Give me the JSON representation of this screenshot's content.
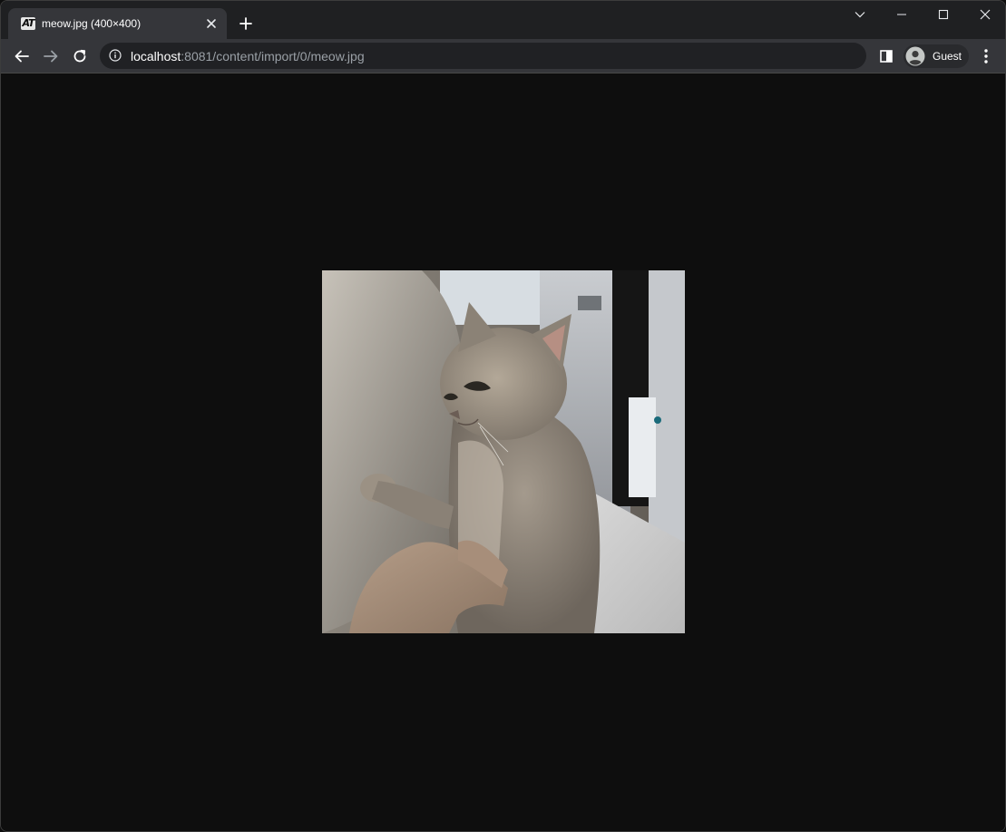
{
  "tab": {
    "favicon_text": "AT",
    "title": "meow.jpg (400×400)",
    "favicon_icon": "at-logo-icon",
    "close_icon": "close-icon"
  },
  "window_controls": {
    "tab_search_icon": "chevron-down-icon",
    "minimize_icon": "minimize-icon",
    "maximize_icon": "maximize-icon",
    "close_icon": "close-icon"
  },
  "toolbar": {
    "back_icon": "arrow-left-icon",
    "forward_icon": "arrow-right-icon",
    "reload_icon": "reload-icon",
    "site_info_icon": "info-icon",
    "url_host": "localhost",
    "url_rest": ":8081/content/import/0/meow.jpg",
    "side_panel_icon": "side-panel-icon",
    "profile_label": "Guest",
    "profile_icon": "avatar-icon",
    "menu_icon": "kebab-menu-icon"
  },
  "content": {
    "image_subject": "photo of a grey kitten sitting on a bed, being held by a hand"
  },
  "colors": {
    "tabstrip_bg": "#1f2022",
    "toolbar_bg": "#35363a",
    "omnibox_bg": "#202124",
    "page_bg": "#0e0e0e",
    "url_secondary": "#9aa0a6"
  }
}
